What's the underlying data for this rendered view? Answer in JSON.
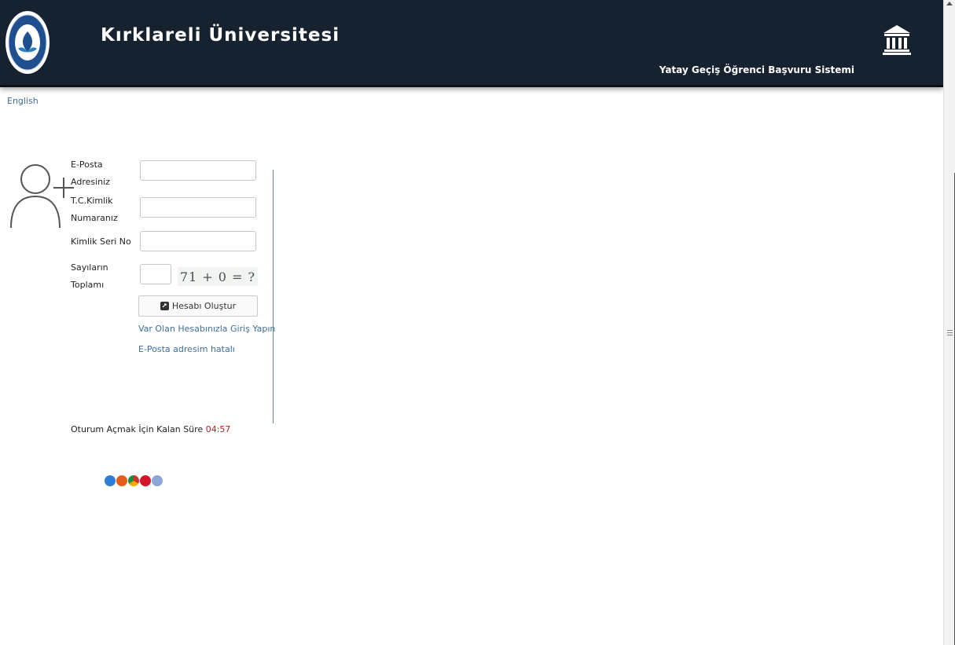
{
  "header": {
    "university_name": "Kırklareli Üniversitesi",
    "system_name": "Yatay Geçiş Öğrenci Başvuru Sistemi",
    "logo_icon": "university-seal-logo",
    "right_icon": "bank-building-icon"
  },
  "language_link": "English",
  "form": {
    "email_label": "E-Posta Adresiniz",
    "tc_label": "T.C.Kimlik Numaranız",
    "serial_label": "Kimlik Seri No",
    "sum_label": "Sayıların Toplamı",
    "captcha_text": "71 + 0 = ?",
    "create_button": "Hesabı Oluştur",
    "login_link": "Var Olan Hesabınızla Giriş Yapın",
    "email_wrong_link": "E-Posta adresim hatalı"
  },
  "session": {
    "label": "Oturum Açmak İçin Kalan Süre",
    "remaining": "04:57"
  },
  "browsers": [
    "internet-explorer-icon",
    "firefox-icon",
    "chrome-icon",
    "opera-icon",
    "safari-icon"
  ],
  "colors": {
    "header_bg": "#172231",
    "link": "#3d6e9c",
    "timer": "#b52020"
  }
}
